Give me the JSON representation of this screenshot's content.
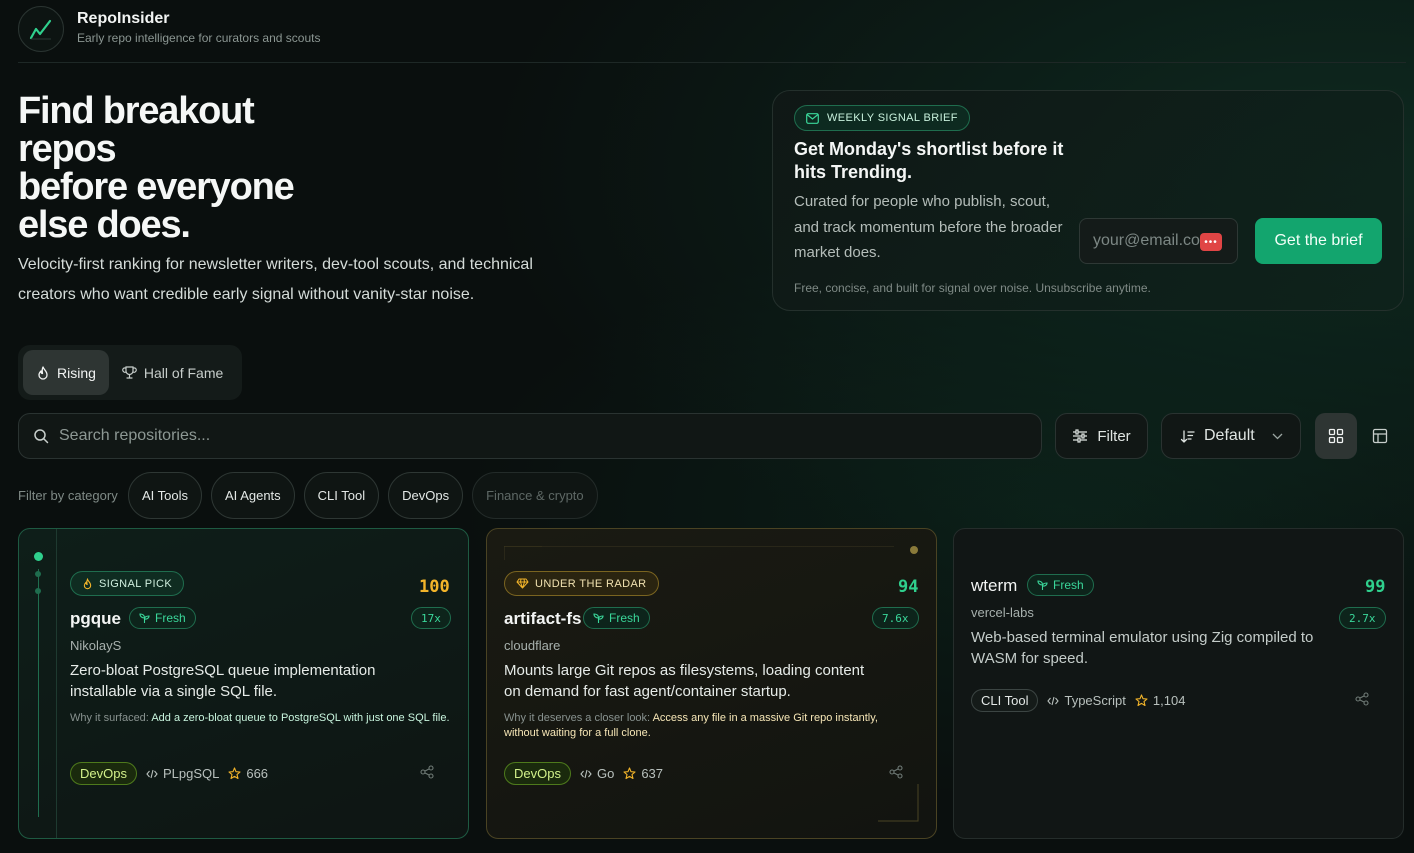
{
  "brand": {
    "name": "RepoInsider",
    "tagline": "Early repo intelligence for curators and scouts"
  },
  "hero": {
    "title_lines": [
      "Find breakout",
      "repos",
      "before everyone",
      "else does."
    ],
    "subtitle": "Velocity-first ranking for newsletter writers, dev-tool scouts, and technical creators who want credible early signal without vanity-star noise."
  },
  "mode_tabs": [
    {
      "label": "Rising",
      "icon": "flame-icon",
      "active": true
    },
    {
      "label": "Hall of Fame",
      "icon": "trophy-icon",
      "active": false
    }
  ],
  "brief": {
    "badge": "WEEKLY SIGNAL BRIEF",
    "title": "Get Monday's shortlist before it hits Trending.",
    "description": "Curated for people who publish, scout, and track momentum before the broader market does.",
    "email_placeholder": "your@email.com",
    "button": "Get the brief",
    "footnote": "Free, concise, and built for signal over noise. Unsubscribe anytime."
  },
  "toolbar": {
    "search_placeholder": "Search repositories...",
    "filter_label": "Filter",
    "sort_label": "Default",
    "view_mode": "grid"
  },
  "categories": {
    "label": "Filter by category",
    "items": [
      {
        "label": "AI Tools",
        "dim": false
      },
      {
        "label": "AI Agents",
        "dim": false
      },
      {
        "label": "CLI Tool",
        "dim": false
      },
      {
        "label": "DevOps",
        "dim": false
      },
      {
        "label": "Finance & crypto",
        "dim": true
      }
    ]
  },
  "repos": [
    {
      "badge": "SIGNAL PICK",
      "score": "100",
      "name": "pgque",
      "fresh": "Fresh",
      "velocity": "17x",
      "owner": "NikolayS",
      "description": "Zero-bloat PostgreSQL queue implementation installable via a single SQL file.",
      "reason_label": "Why it surfaced:",
      "reason": "Add a zero-bloat queue to PostgreSQL with just one SQL file.",
      "tag": "DevOps",
      "language": "PLpgSQL",
      "stars": "666"
    },
    {
      "badge": "UNDER THE RADAR",
      "score": "94",
      "name": "artifact-fs",
      "fresh": "Fresh",
      "velocity": "7.6x",
      "owner": "cloudflare",
      "description": "Mounts large Git repos as filesystems, loading content on demand for fast agent/container startup.",
      "reason_label": "Why it deserves a closer look:",
      "reason": "Access any file in a massive Git repo instantly, without waiting for a full clone.",
      "tag": "DevOps",
      "language": "Go",
      "stars": "637"
    },
    {
      "score": "99",
      "name": "wterm",
      "fresh": "Fresh",
      "velocity": "2.7x",
      "owner": "vercel-labs",
      "description": "Web-based terminal emulator using Zig compiled to WASM for speed.",
      "tag": "CLI Tool",
      "language": "TypeScript",
      "stars": "1,104"
    }
  ],
  "colors": {
    "accent_green": "#13a56e",
    "score_gold": "#f2b42a",
    "score_green": "#2fd08d"
  }
}
